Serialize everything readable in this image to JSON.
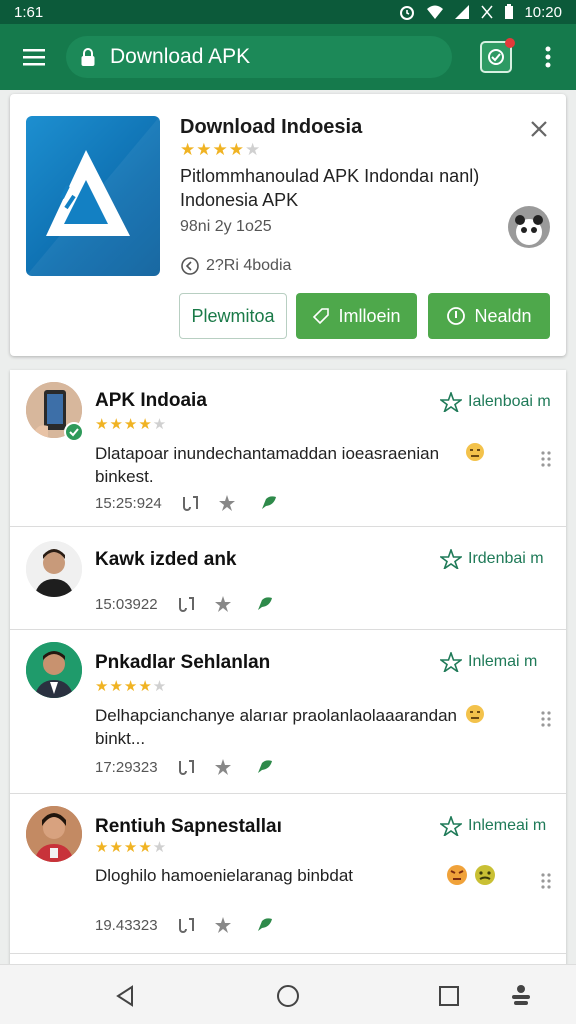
{
  "status_bar": {
    "time": "1:61",
    "clock": "10:20"
  },
  "app_bar": {
    "url_text": "Download APK"
  },
  "app": {
    "title": "Download Indoesia",
    "stars": 4,
    "description": "Pitlommhanoulad APK Indondaı nanl) Indonesia APK",
    "date": "98ni 2y 1o25",
    "downloads": "2?Ri 4bodia",
    "buttons": {
      "outline": "Plewmitoa",
      "install": "Imlloein",
      "info": "Nealdn"
    }
  },
  "reviews": [
    {
      "name": "APK Indoaia",
      "stars": 3.5,
      "text": "Dlatapoar inundechantamaddan ioeasraenian binkest.",
      "date": "15:25:924",
      "action": "Ialenboai m",
      "verified": true,
      "emoji": [
        "neutral-face"
      ]
    },
    {
      "name": "Kawk izded ank",
      "stars": 0,
      "text": "",
      "date": "15:03922",
      "action": "Irdenbai m",
      "verified": false,
      "emoji": []
    },
    {
      "name": "Pnkadlar Sehlanlan",
      "stars": 3.5,
      "text": "Delhapcianchanye alarıar praolanlaolaaarandan binkt...",
      "date": "17:29323",
      "action": "Inlemai m",
      "verified": false,
      "emoji": [
        "neutral-face"
      ]
    },
    {
      "name": "Rentiuh Sapnestallaı",
      "stars": 3.5,
      "text": "Dloghilo hamoenielaranag binbdat",
      "date": "19.43323",
      "action": "Inlemeai m",
      "verified": false,
      "emoji": [
        "angry-face",
        "sick-face"
      ]
    }
  ],
  "colors": {
    "primary": "#157a4c",
    "status": "#0c5a3a",
    "accent_green": "#4ea84b",
    "star": "#f0b323"
  }
}
